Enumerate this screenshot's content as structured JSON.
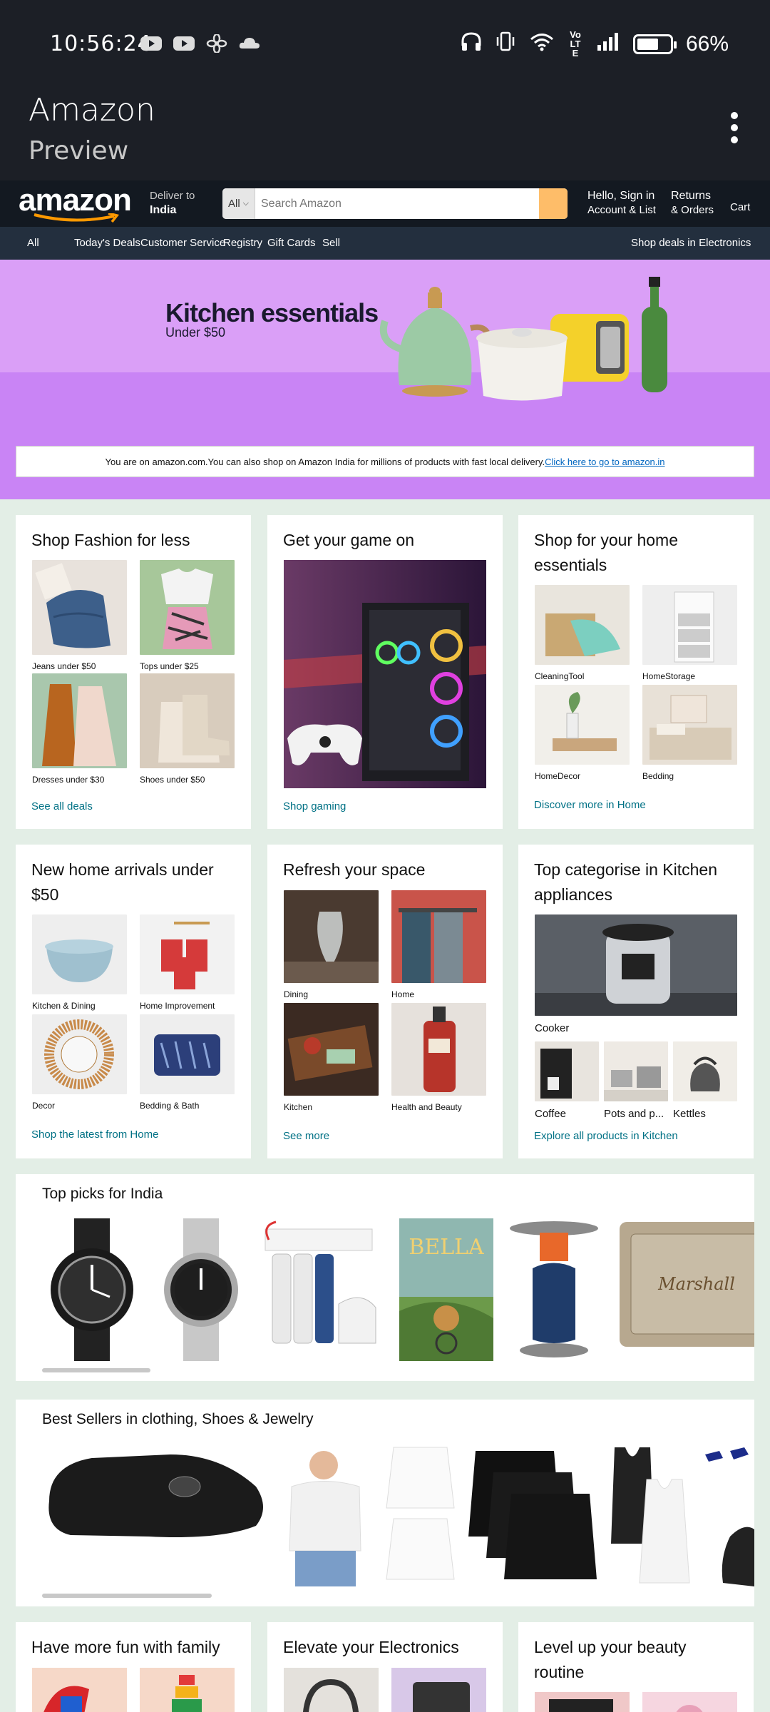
{
  "status": {
    "time": "10:56:24",
    "battery_percent": "66%",
    "battery_level": 0.66,
    "network": "VoLTE"
  },
  "app": {
    "title": "Amazon",
    "subtitle": "Preview"
  },
  "nav": {
    "logo": "amazon",
    "deliver_label": "Deliver to",
    "deliver_location": "India",
    "search_scope": "All",
    "search_placeholder": "Search Amazon",
    "account_line1": "Hello, Sign in",
    "account_line2": "Account & List",
    "returns_line1": "Returns",
    "returns_line2": "& Orders",
    "cart": "Cart"
  },
  "subnav": {
    "all": "All",
    "items": [
      "Today's Deals",
      "Customer Service",
      "Registry",
      "Gift Cards",
      "Sell"
    ],
    "promo": "Shop deals in Electronics"
  },
  "hero": {
    "title": "Kitchen essentials",
    "subtitle": "Under $50",
    "notice_text": "You are on amazon.com.You can also shop on Amazon India for millions of products with fast local delivery.",
    "notice_link": "Click here to go to amazon.in"
  },
  "cards_row1": [
    {
      "title": "Shop Fashion for less",
      "tiles": [
        "Jeans under $50",
        "Tops under $25",
        "Dresses under $30",
        "Shoes under $50"
      ],
      "link": "See all deals"
    },
    {
      "title": "Get your game on",
      "link": "Shop gaming"
    },
    {
      "title": "Shop for your home essentials",
      "tiles": [
        "CleaningTool",
        "HomeStorage",
        "HomeDecor",
        "Bedding"
      ],
      "link": "Discover more in Home"
    }
  ],
  "cards_row2": [
    {
      "title": "New home arrivals under $50",
      "tiles": [
        "Kitchen & Dining",
        "Home Improvement",
        "Decor",
        "Bedding & Bath"
      ],
      "link": "Shop the latest from Home"
    },
    {
      "title": "Refresh your space",
      "tiles": [
        "Dining",
        "Home",
        "Kitchen",
        "Health and Beauty"
      ],
      "link": "See more"
    },
    {
      "title": "Top categorise in Kitchen appliances",
      "main_tile": "Cooker",
      "tiles": [
        "Coffee",
        "Pots and p...",
        "Kettles"
      ],
      "link": "Explore all products in Kitchen"
    }
  ],
  "top_picks": {
    "title": "Top picks for India",
    "book_title": "BELLA"
  },
  "best_sellers": {
    "title": "Best Sellers in clothing, Shoes & Jewelry"
  },
  "cards_row3": [
    {
      "title": "Have more fun with family"
    },
    {
      "title": "Elevate your Electronics"
    },
    {
      "title": "Level up your beauty routine"
    }
  ],
  "colors": {
    "status_bg": "#1c1f26",
    "amazon_nav": "#131921",
    "amazon_subnav": "#232f3e",
    "hero_bg": "#c984f5",
    "link": "#007185",
    "search_button": "#febd69",
    "page_bg": "#e3eee6"
  }
}
